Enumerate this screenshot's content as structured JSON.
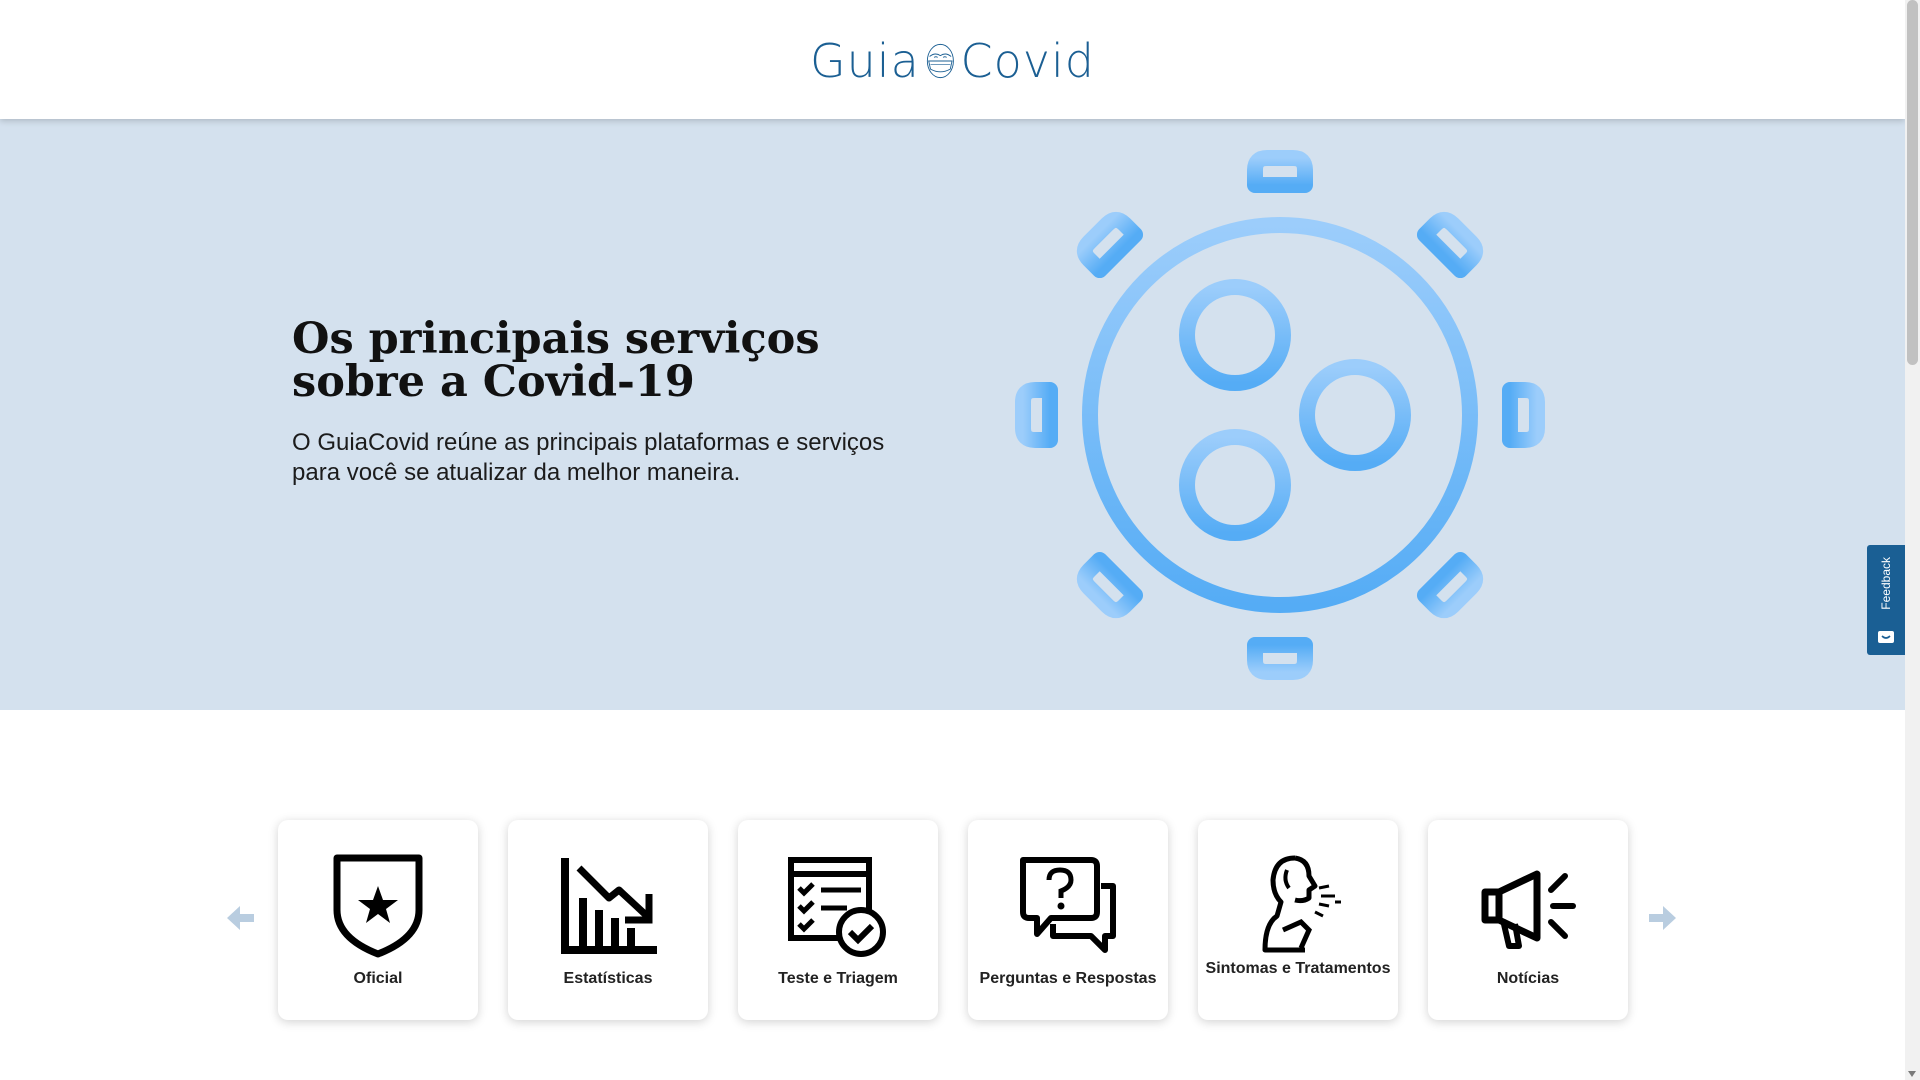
{
  "header": {
    "logo_left": "Guia",
    "logo_right": "Covid",
    "brand_color": "#1b5f93"
  },
  "hero": {
    "title": "Os principais serviços sobre a Covid-19",
    "subtitle": "O GuiaCovid reúne as principais plataformas e serviços para você se atualizar da melhor maneira.",
    "background": "#d4e1ee",
    "illustration": "virus-icon"
  },
  "feedback": {
    "label": "Feedback",
    "color": "#1a5f94"
  },
  "carousel": {
    "prev_icon": "arrow-left-icon",
    "next_icon": "arrow-right-icon",
    "arrow_color": "#b9cde0",
    "items": [
      {
        "label": "Oficial",
        "icon": "shield-star-icon"
      },
      {
        "label": "Estatísticas",
        "icon": "chart-down-icon"
      },
      {
        "label": "Teste e Triagem",
        "icon": "checklist-icon"
      },
      {
        "label": "Perguntas e Respostas",
        "icon": "question-chat-icon"
      },
      {
        "label": "Sintomas e Tratamentos",
        "icon": "cough-person-icon"
      },
      {
        "label": "Notícias",
        "icon": "megaphone-icon"
      }
    ]
  }
}
